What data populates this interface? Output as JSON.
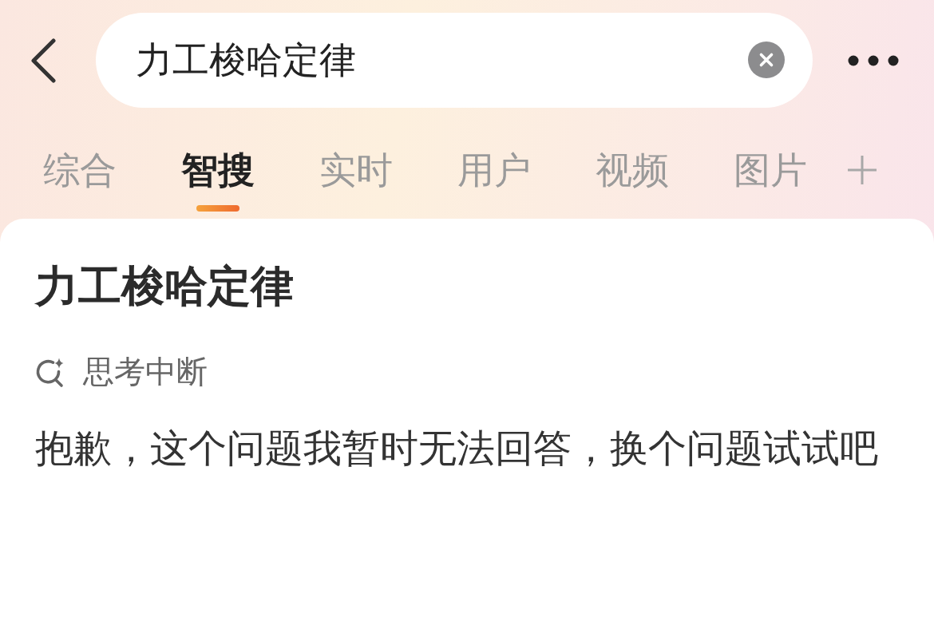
{
  "search": {
    "value": "力工梭哈定律"
  },
  "tabs": [
    {
      "label": "综合",
      "selected": false
    },
    {
      "label": "智搜",
      "selected": true
    },
    {
      "label": "实时",
      "selected": false
    },
    {
      "label": "用户",
      "selected": false
    },
    {
      "label": "视频",
      "selected": false
    },
    {
      "label": "图片",
      "selected": false
    }
  ],
  "result": {
    "title": "力工梭哈定律",
    "status": {
      "label": "思考中断"
    },
    "answer": "抱歉，这个问题我暂时无法回答，换个问题试试吧"
  }
}
